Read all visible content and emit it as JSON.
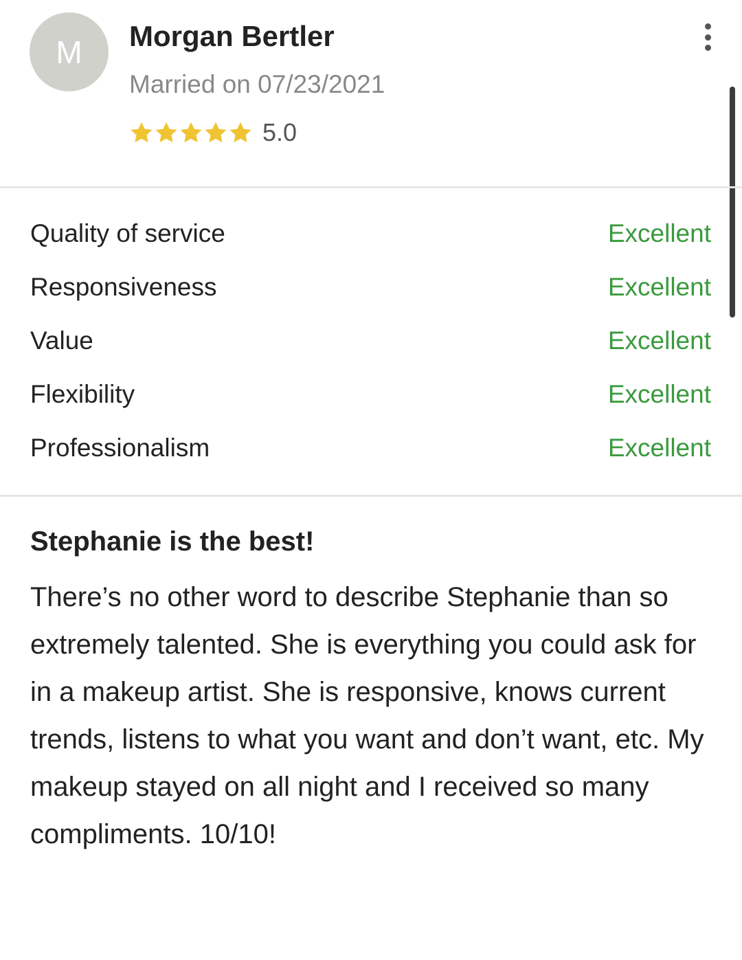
{
  "reviewer": {
    "initial": "M",
    "name": "Morgan Bertler",
    "married": "Married on 07/23/2021",
    "stars": 5,
    "rating": "5.0"
  },
  "icons": {
    "star": "star-icon",
    "more": "more-vertical-icon"
  },
  "colors": {
    "star": "#f0c332",
    "grade": "#3a9a3e",
    "avatar": "#d1d1cc"
  },
  "ratings": [
    {
      "label": "Quality of service",
      "grade": "Excellent"
    },
    {
      "label": "Responsiveness",
      "grade": "Excellent"
    },
    {
      "label": "Value",
      "grade": "Excellent"
    },
    {
      "label": "Flexibility",
      "grade": "Excellent"
    },
    {
      "label": "Professionalism",
      "grade": "Excellent"
    }
  ],
  "review": {
    "title": "Stephanie is the best!",
    "body": "There’s no other word to describe Stephanie than so extremely talented. She is everything you could ask for in a makeup artist. She is responsive, knows current trends, listens to what you want and don’t want, etc. My makeup stayed on all night and I received so many compliments. 10/10!"
  }
}
